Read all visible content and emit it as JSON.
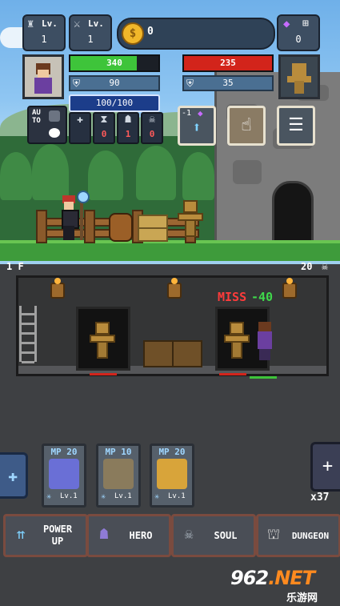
{
  "hud": {
    "weapon_level": {
      "label": "Lv.",
      "value": "1",
      "icon": "armor-icon"
    },
    "sword_level": {
      "label": "Lv.",
      "value": "1",
      "icon": "sword-icon"
    },
    "coins": {
      "icon_glyph": "$",
      "value": "0"
    },
    "gems": {
      "value": "0",
      "icon": "diamond-icon"
    }
  },
  "player": {
    "hp": "340",
    "hp_fraction": 0.75,
    "defense": "90",
    "mp": "100/100"
  },
  "enemy": {
    "hp": "235",
    "hp_fraction": 1.0,
    "defense": "35"
  },
  "auto": {
    "label": "AU\nTO"
  },
  "stats": [
    {
      "icon": "potion-icon",
      "glyph": "✚",
      "value": ""
    },
    {
      "icon": "hourglass-icon",
      "glyph": "⧗",
      "value": "0"
    },
    {
      "icon": "helmet-icon",
      "glyph": "☗",
      "value": "1"
    },
    {
      "icon": "skull-icon",
      "glyph": "☠",
      "value": "0"
    }
  ],
  "top_buttons": {
    "upgrade": {
      "mini": "-1",
      "icon": "arrow-up-icon"
    },
    "tap": {
      "icon": "hand-pointer-icon"
    },
    "menu": {
      "icon": "hamburger-menu-icon"
    }
  },
  "dungeon": {
    "floor": "1 F",
    "kills": "20",
    "miss_text": "MISS",
    "damage_text": "-40"
  },
  "skills": [
    {
      "mp": "MP 20",
      "level": "Lv.1",
      "color": "#6a6fd6"
    },
    {
      "mp": "MP 10",
      "level": "Lv.1",
      "color": "#8a7b5c"
    },
    {
      "mp": "MP 20",
      "level": "Lv.1",
      "color": "#d8a43a"
    }
  ],
  "skill_book": {
    "count": "x37"
  },
  "tabs": [
    {
      "label": "POWER\nUP",
      "icon": "power-up-arrows-icon"
    },
    {
      "label": "HERO",
      "icon": "hero-helmet-icon"
    },
    {
      "label": "SOUL",
      "icon": "soul-skull-icon"
    },
    {
      "label": "DUNGEON",
      "icon": "dungeon-gate-icon"
    }
  ],
  "watermark": {
    "logo": "962",
    "domain": ".NET",
    "sub": "乐游网"
  },
  "colors": {
    "hp": "#3ec43a",
    "enemy_hp": "#d2241b",
    "mp": "#1c3d8a",
    "damage": "#3fd74b",
    "miss": "#ff3b3b"
  }
}
